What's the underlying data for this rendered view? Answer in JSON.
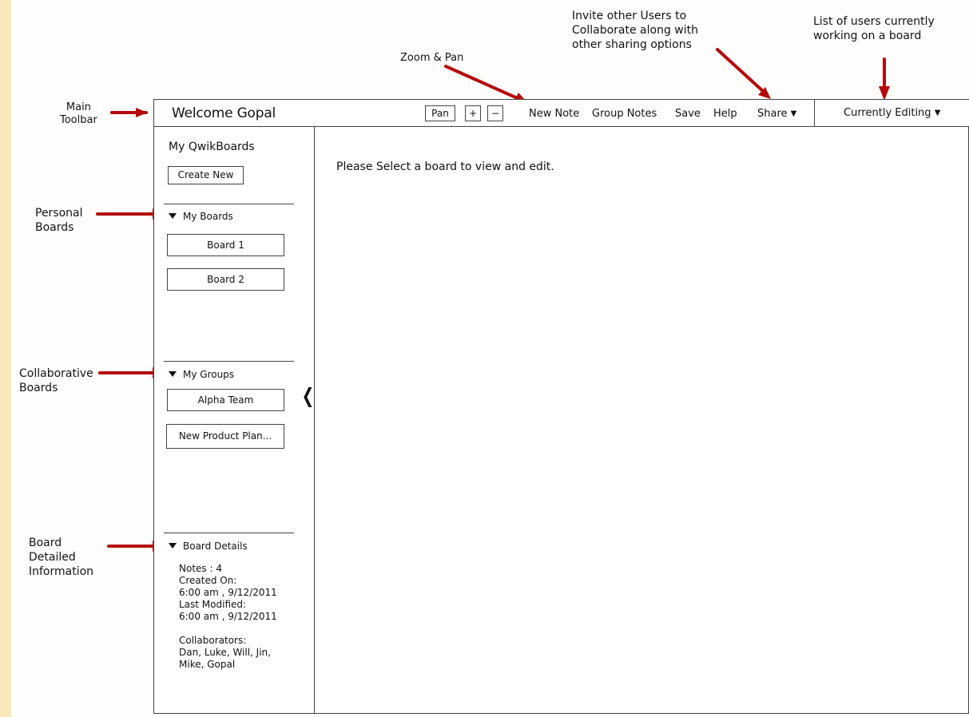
{
  "annotations": {
    "main_toolbar": "Main\nToolbar",
    "zoom_pan": "Zoom & Pan",
    "share": "Invite other Users to\nCollaborate along with\nother sharing options",
    "currently_editing": "List of users currently\nworking on a board",
    "personal_boards": "Personal\nBoards",
    "collaborative_boards": "Collaborative\nBoards",
    "board_details": "Board\nDetailed\nInformation"
  },
  "toolbar": {
    "welcome": "Welcome Gopal",
    "pan": "Pan",
    "zoom_in": "+",
    "zoom_out": "−",
    "new_note": "New Note",
    "group_notes": "Group Notes",
    "save": "Save",
    "help": "Help",
    "share": "Share",
    "currently_editing": "Currently Editing"
  },
  "sidebar": {
    "title": "My QwikBoards",
    "create_new": "Create New",
    "my_boards": "My Boards",
    "boards": [
      "Board 1",
      "Board 2"
    ],
    "my_groups": "My Groups",
    "groups": [
      "Alpha Team",
      "New Product Plan..."
    ],
    "board_details_title": "Board Details",
    "details": "Notes : 4\nCreated On:\n6:00 am , 9/12/2011\nLast Modified:\n6:00 am , 9/12/2011\n\nCollaborators:\nDan, Luke, Will, Jin,\nMike, Gopal",
    "collapse_icon": "chevron-left-icon"
  },
  "main": {
    "message": "Please Select a board to view and edit."
  },
  "colors": {
    "annotation_arrow": "#b50a0a",
    "background_margin": "#fae8bb",
    "frame": "#444444"
  }
}
